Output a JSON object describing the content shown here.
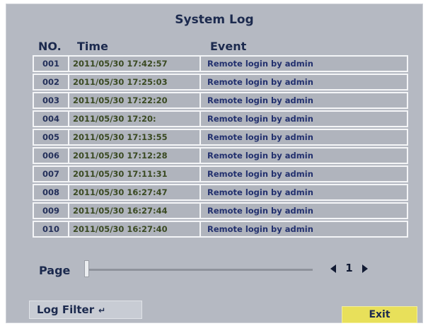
{
  "title": "System Log",
  "headers": {
    "no": "NO.",
    "time": "Time",
    "event": "Event"
  },
  "rows": [
    {
      "no": "001",
      "time": "2011/05/30 17:42:57",
      "event": "Remote login by admin"
    },
    {
      "no": "002",
      "time": "2011/05/30 17:25:03",
      "event": "Remote login by admin"
    },
    {
      "no": "003",
      "time": "2011/05/30 17:22:20",
      "event": "Remote login by admin"
    },
    {
      "no": "004",
      "time": "2011/05/30 17:20:",
      "event": "Remote login by admin"
    },
    {
      "no": "005",
      "time": "2011/05/30 17:13:55",
      "event": "Remote login by admin"
    },
    {
      "no": "006",
      "time": "2011/05/30 17:12:28",
      "event": "Remote login by admin"
    },
    {
      "no": "007",
      "time": "2011/05/30 17:11:31",
      "event": "Remote login by admin"
    },
    {
      "no": "008",
      "time": "2011/05/30 16:27:47",
      "event": "Remote login by admin"
    },
    {
      "no": "009",
      "time": "2011/05/30 16:27:44",
      "event": "Remote login by admin"
    },
    {
      "no": "010",
      "time": "2011/05/30 16:27:40",
      "event": "Remote login by admin"
    }
  ],
  "pager": {
    "label": "Page",
    "current": "1",
    "position_fraction": 0
  },
  "buttons": {
    "log_filter": "Log Filter",
    "exit": "Exit"
  },
  "icons": {
    "prev": "prev-page-icon",
    "next": "next-page-icon",
    "enter": "enter-key-icon"
  },
  "colors": {
    "background": "#b5b9c2",
    "exit_button": "#e8e05a",
    "row_border": "#f4f5f7"
  }
}
